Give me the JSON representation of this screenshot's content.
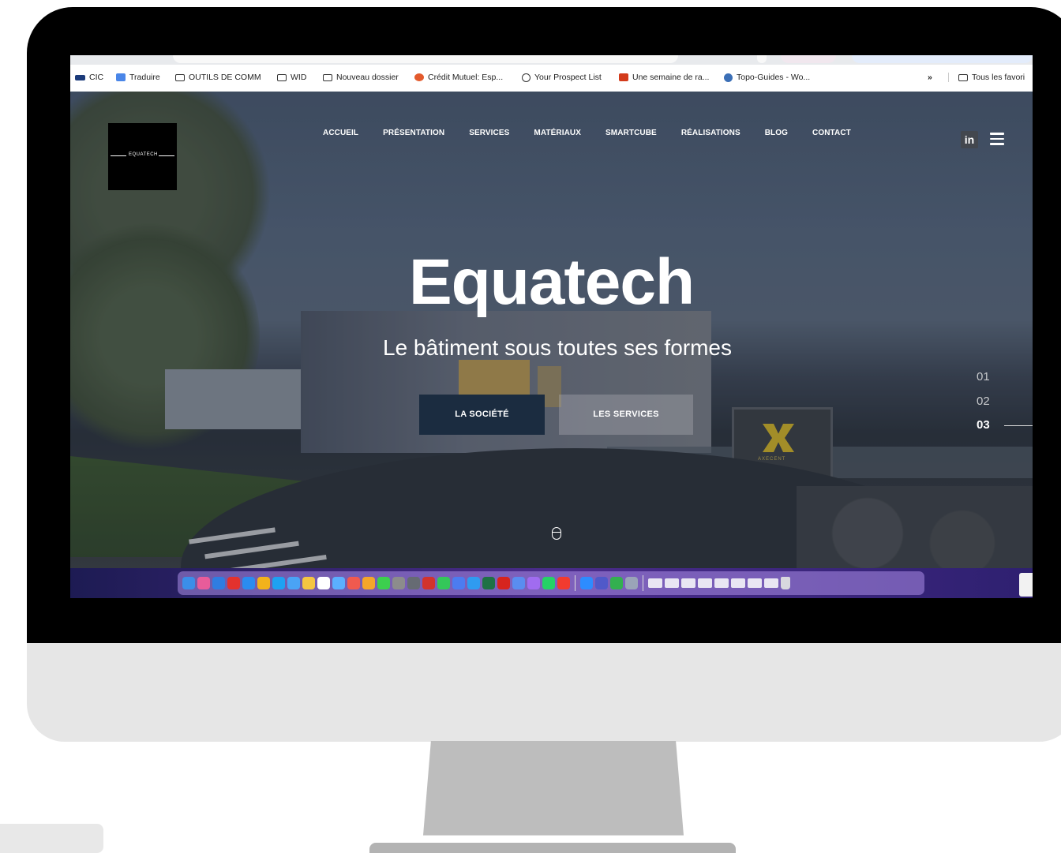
{
  "bookmarks": {
    "items": [
      {
        "label": "CIC",
        "icon": "cic-icon"
      },
      {
        "label": "Traduire",
        "icon": "translate-icon"
      },
      {
        "label": "OUTILS DE COMM",
        "icon": "folder-icon"
      },
      {
        "label": "WID",
        "icon": "folder-icon"
      },
      {
        "label": "Nouveau dossier",
        "icon": "folder-icon"
      },
      {
        "label": "Crédit Mutuel: Esp...",
        "icon": "credit-mutuel-icon"
      },
      {
        "label": "Your Prospect List",
        "icon": "globe-icon"
      },
      {
        "label": "Une semaine de ra...",
        "icon": "page-icon"
      },
      {
        "label": "Topo-Guides - Wo...",
        "icon": "wordpress-icon"
      }
    ],
    "overflow_label": "»",
    "all_bookmarks_label": "Tous les favori"
  },
  "site": {
    "logo_text": "EQUATECH",
    "nav": [
      "ACCUEIL",
      "PRÉSENTATION",
      "SERVICES",
      "MATÉRIAUX",
      "SMARTCUBE",
      "RÉALISATIONS",
      "BLOG",
      "CONTACT"
    ],
    "linkedin_label": "in",
    "hero_title": "Equatech",
    "hero_tagline": "Le bâtiment sous toutes ses formes",
    "button_primary": "LA SOCIÉTÉ",
    "button_secondary": "LES SERVICES",
    "slides": [
      "01",
      "02",
      "03"
    ],
    "active_slide": "03",
    "cube_text": "AXECENT"
  },
  "colors": {
    "primary_button": "#1b2c40",
    "dock_gradient_start": "#1d1b53",
    "dock_gradient_end": "#4b2c8c",
    "bezel": "#000000",
    "chin": "#e6e6e6",
    "stand": "#bdbdbd"
  },
  "dock": {
    "icons": [
      "finder-icon",
      "launchpad-icon",
      "safari-icon",
      "opera-icon",
      "app-store-icon",
      "chrome-icon",
      "skype-icon",
      "mail-icon",
      "notes-icon",
      "calendar-icon",
      "wave-icon",
      "reminders-icon",
      "photos-icon",
      "messages-icon",
      "settings-icon",
      "calculator-icon",
      "photo-booth-icon",
      "maps-icon",
      "mail-alt-icon",
      "browser-icon",
      "spreadsheet-icon",
      "acrobat-icon",
      "utility-icon",
      "star-icon",
      "whatsapp-icon",
      "record-icon",
      "zoom-icon",
      "teams-icon",
      "evernote-icon",
      "remote-icon",
      "window-icon",
      "window-icon",
      "window-icon",
      "window-icon",
      "window-icon",
      "window-icon",
      "window-icon",
      "window-icon",
      "trash-icon"
    ]
  }
}
